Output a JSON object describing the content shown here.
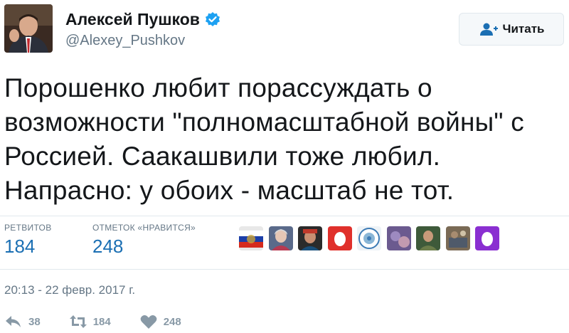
{
  "author": {
    "name": "Алексей Пушков",
    "handle": "@Alexey_Pushkov",
    "verified": true,
    "icons": {
      "avatar": "avatar-photo",
      "verified": "verified-badge-icon"
    }
  },
  "follow_button": {
    "label": "Читать",
    "icon": "add-user-icon"
  },
  "tweet": {
    "lines": [
      "Порошенко любит порассуждать о",
      "возможности \"полномасштабной войны\" с",
      "Россией. Саакашвили  тоже любил.",
      "Напрасно: у обоих - масштаб не тот."
    ]
  },
  "stats": {
    "retweets": {
      "label": "РЕТВИТОВ",
      "value": "184"
    },
    "likes": {
      "label": "ОТМЕТОК «НРАВИТСЯ»",
      "value": "248"
    }
  },
  "liked_by": [
    {
      "avatar": "russian-flag-avatar"
    },
    {
      "avatar": "person-avatar"
    },
    {
      "avatar": "person-avatar"
    },
    {
      "avatar": "red-egg-avatar"
    },
    {
      "avatar": "emblem-avatar"
    },
    {
      "avatar": "photo-avatar"
    },
    {
      "avatar": "person-avatar"
    },
    {
      "avatar": "photo-avatar"
    },
    {
      "avatar": "purple-egg-avatar"
    }
  ],
  "timestamp": "20:13 - 22 февр. 2017 г.",
  "actions": {
    "reply": {
      "count": "38",
      "icon": "reply-icon"
    },
    "retweet": {
      "count": "184",
      "icon": "retweet-icon"
    },
    "like": {
      "count": "248",
      "icon": "heart-icon"
    }
  },
  "colors": {
    "link_blue": "#1b6fb3",
    "verified_blue": "#1da1f2",
    "muted": "#657786",
    "action_gray": "#8899a6"
  }
}
